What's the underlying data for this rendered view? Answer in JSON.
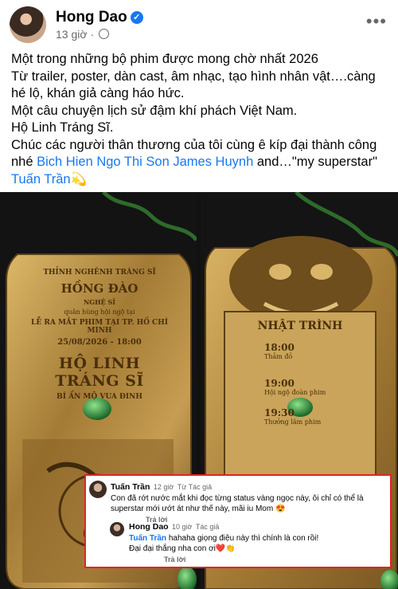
{
  "post": {
    "author": "Hong Dao",
    "time": "13 giờ",
    "dot": "·",
    "more": "•••",
    "lines": [
      "Một trong những bộ phim được mong chờ nhất 2026",
      "Từ trailer, poster, dàn cast, âm nhạc, tạo hình nhân vật….càng hé lộ, khán giả càng háo hức.",
      "Một câu chuyện lịch sử đậm khí phách Việt Nam.",
      "Hộ Linh Tráng Sĩ."
    ],
    "last_pre": "Chúc các người thân thương của tôi cùng ê kíp đại thành công nhé ",
    "mention1": "Bich Hien Ngo",
    "mention2": "Thi Son",
    "mention3": "James Huynh",
    "and_text": " and…\"my superstar\" ",
    "mention4": "Tuấn Trần",
    "emoji": "💫"
  },
  "invite_left": {
    "line1": "THỈNH NGHÊNH TRÁNG SĨ",
    "name": "HỒNG ĐÀO",
    "role": "NGHỆ SĨ",
    "line2": "quân hùng hội ngộ tại",
    "line3": "LỄ RA MẮT PHIM TẠI TP. HỒ CHÍ MINH",
    "datetime": "25/08/2026 - 18:00",
    "title": "HỘ LINH TRÁNG SĨ",
    "subtitle": "BÍ ẨN MỘ VUA ĐINH"
  },
  "invite_right": {
    "heading": "NHẬT TRÌNH",
    "items": [
      {
        "time": "18:00",
        "label": "Thảm đỏ"
      },
      {
        "time": "19:00",
        "label": "Hội ngộ đoàn phim"
      },
      {
        "time": "19:30",
        "label": "Thưởng lãm phim"
      }
    ]
  },
  "comments": [
    {
      "name": "Tuấn Trần",
      "time": "12 giờ",
      "badge": "Từ Tác giả",
      "text": "Con đã rớt nước mắt khi đọc từng status vàng ngọc này, ôi chỉ có thể là superstar mới ướt át như thế này, mãi iu Mom 😍",
      "reply": "Trả lời"
    },
    {
      "name": "Hong Dao",
      "time": "10 giờ",
      "badge": "Tác giả",
      "mention": "Tuấn Trần",
      "text": " hahaha giọng điệu này thì chính là con rồi!",
      "text2": "Đại đại thắng nha con ơi❤️👏",
      "reply": "Trả lời"
    }
  ],
  "colors": {
    "link": "#1877f2",
    "highlight": "#e02424"
  }
}
